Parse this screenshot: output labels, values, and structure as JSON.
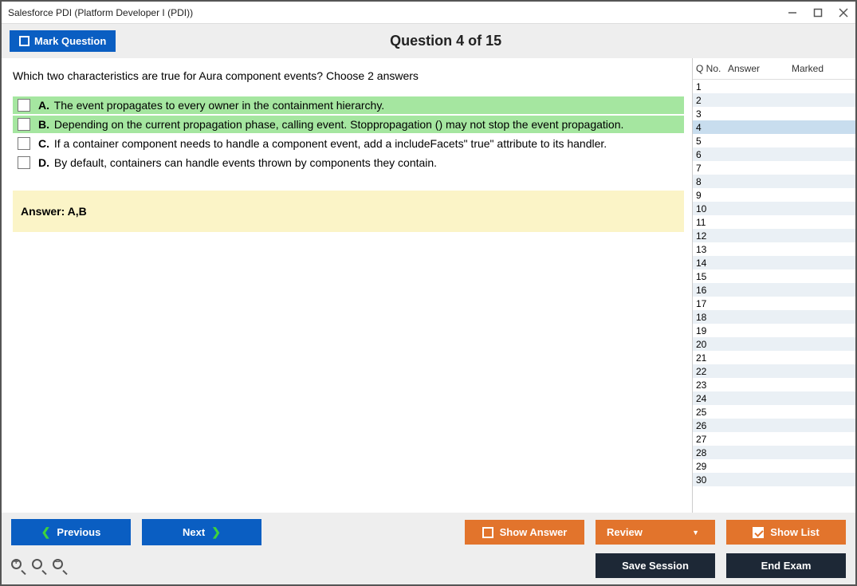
{
  "window": {
    "title": "Salesforce PDI (Platform Developer I (PDI))"
  },
  "header": {
    "mark_label": "Mark Question",
    "counter": "Question 4 of 15"
  },
  "question": {
    "text": "Which two characteristics are true for Aura component events? Choose 2 answers",
    "options": [
      {
        "letter": "A.",
        "text": "The event propagates to every owner in the containment hierarchy.",
        "correct": true
      },
      {
        "letter": "B.",
        "text": "Depending on the current propagation phase, calling event. Stoppropagation () may not stop the event propagation.",
        "correct": true
      },
      {
        "letter": "C.",
        "text": "If a container component needs to handle a component event, add a includeFacets\" true\" attribute to its handler.",
        "correct": false
      },
      {
        "letter": "D.",
        "text": "By default, containers can handle events thrown by components they contain.",
        "correct": false
      }
    ],
    "answer_label": "Answer: A,B"
  },
  "sidebar": {
    "columns": [
      "Q No.",
      "Answer",
      "Marked"
    ],
    "selected": 4,
    "count": 30
  },
  "footer": {
    "previous": "Previous",
    "next": "Next",
    "show_answer": "Show Answer",
    "review": "Review",
    "show_list": "Show List",
    "save_session": "Save Session",
    "end_exam": "End Exam"
  }
}
